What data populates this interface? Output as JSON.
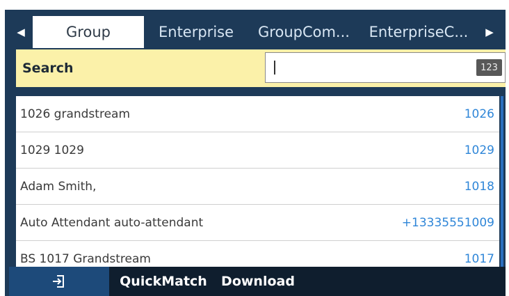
{
  "tabs": {
    "items": [
      {
        "label": "Group",
        "active": true
      },
      {
        "label": "Enterprise",
        "active": false
      },
      {
        "label": "GroupCom...",
        "active": false
      },
      {
        "label": "EnterpriseC...",
        "active": false
      }
    ],
    "left_arrow_icon": "chevron-left-icon",
    "right_arrow_icon": "chevron-right-icon"
  },
  "search": {
    "label": "Search",
    "value": "",
    "input_mode": "123"
  },
  "contacts": [
    {
      "name": "1026 grandstream",
      "number": "1026"
    },
    {
      "name": "1029 1029",
      "number": "1029"
    },
    {
      "name": "Adam Smith,",
      "number": "1018"
    },
    {
      "name": "Auto Attendant auto-attendant",
      "number": "+13335551009"
    },
    {
      "name": "BS 1017 Grandstream",
      "number": "1017"
    }
  ],
  "softkeys": {
    "exit_icon": "exit-icon",
    "quickmatch": "QuickMatch",
    "download": "Download"
  },
  "colors": {
    "background": "#1d3a58",
    "search_bar": "#fbf1a9",
    "number_text": "#2f86d8",
    "softkey_bar": "#0f1e2e"
  }
}
